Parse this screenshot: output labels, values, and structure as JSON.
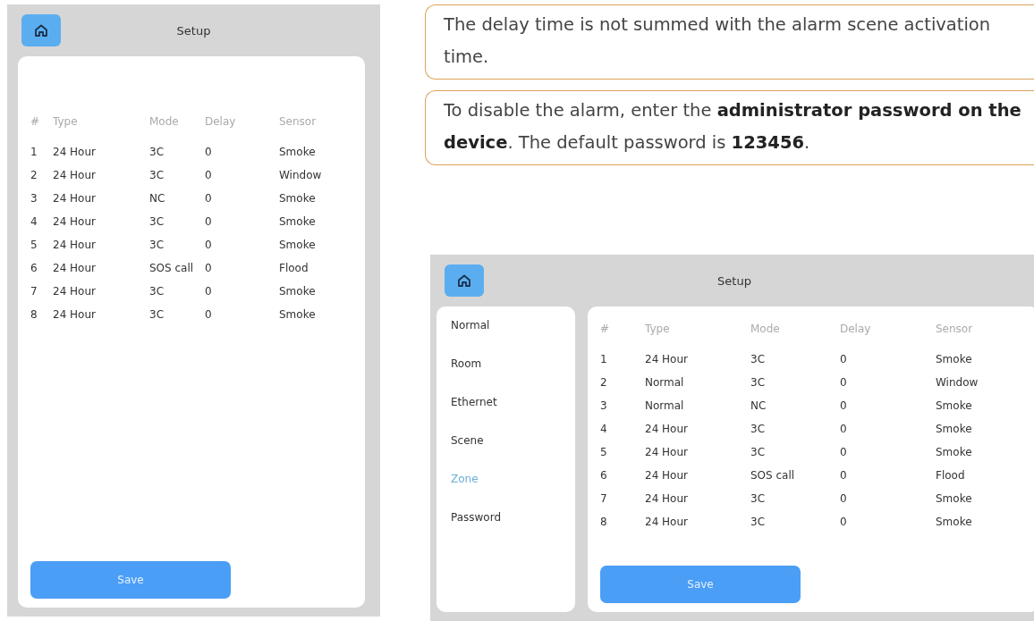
{
  "notes": [
    {
      "text": "The delay time is not summed with the alarm scene activation time."
    },
    {
      "text": "To disable the alarm, enter the **administrator password on the device**. The default password is **123456**."
    }
  ],
  "screens": [
    {
      "title": "Setup",
      "columns": [
        "#",
        "Type",
        "Mode",
        "Delay",
        "Sensor"
      ],
      "rows": [
        [
          "1",
          "24 Hour",
          "3C",
          "0",
          "Smoke"
        ],
        [
          "2",
          "24 Hour",
          "3C",
          "0",
          "Window"
        ],
        [
          "3",
          "24 Hour",
          "NC",
          "0",
          "Smoke"
        ],
        [
          "4",
          "24 Hour",
          "3C",
          "0",
          "Smoke"
        ],
        [
          "5",
          "24 Hour",
          "3C",
          "0",
          "Smoke"
        ],
        [
          "6",
          "24 Hour",
          "SOS call",
          "0",
          "Flood"
        ],
        [
          "7",
          "24 Hour",
          "3C",
          "0",
          "Smoke"
        ],
        [
          "8",
          "24 Hour",
          "3C",
          "0",
          "Smoke"
        ]
      ],
      "save": "Save"
    },
    {
      "title": "Setup",
      "sidebar": [
        {
          "label": "Normal",
          "selected": false
        },
        {
          "label": "Room",
          "selected": false
        },
        {
          "label": "Ethernet",
          "selected": false
        },
        {
          "label": "Scene",
          "selected": false
        },
        {
          "label": "Zone",
          "selected": true
        },
        {
          "label": "Password",
          "selected": false
        }
      ],
      "columns": [
        "#",
        "Type",
        "Mode",
        "Delay",
        "Sensor"
      ],
      "rows": [
        [
          "1",
          "24 Hour",
          "3C",
          "0",
          "Smoke"
        ],
        [
          "2",
          "Normal",
          "3C",
          "0",
          "Window"
        ],
        [
          "3",
          "Normal",
          "NC",
          "0",
          "Smoke"
        ],
        [
          "4",
          "24 Hour",
          "3C",
          "0",
          "Smoke"
        ],
        [
          "5",
          "24 Hour",
          "3C",
          "0",
          "Smoke"
        ],
        [
          "6",
          "24 Hour",
          "SOS call",
          "0",
          "Flood"
        ],
        [
          "7",
          "24 Hour",
          "3C",
          "0",
          "Smoke"
        ],
        [
          "8",
          "24 Hour",
          "3C",
          "0",
          "Smoke"
        ]
      ],
      "save": "Save"
    }
  ]
}
